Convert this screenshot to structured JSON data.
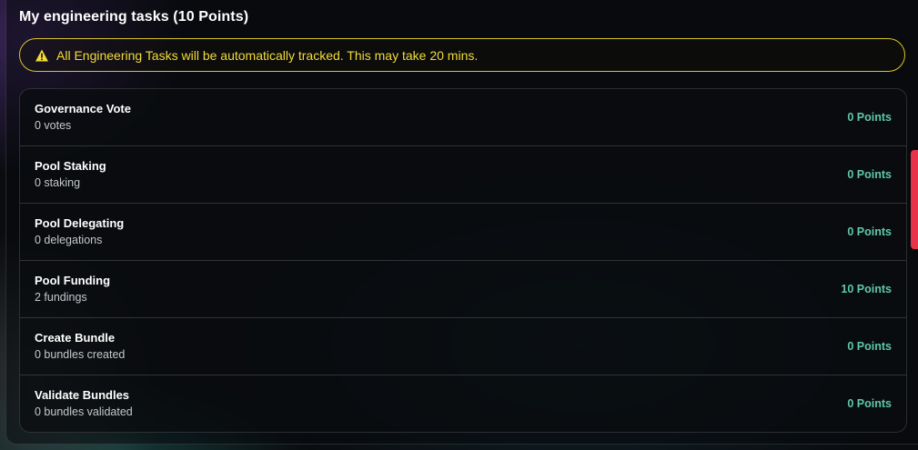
{
  "header": {
    "title": "My engineering tasks (10 Points)"
  },
  "alert": {
    "icon": "warning-icon",
    "text": "All Engineering Tasks will be automatically tracked. This may take 20 mins.",
    "color": "#f3dc38"
  },
  "tasks": [
    {
      "name": "Governance Vote",
      "detail": "0 votes",
      "points": "0 Points"
    },
    {
      "name": "Pool Staking",
      "detail": "0 staking",
      "points": "0 Points"
    },
    {
      "name": "Pool Delegating",
      "detail": "0 delegations",
      "points": "0 Points"
    },
    {
      "name": "Pool Funding",
      "detail": "2 fundings",
      "points": "10 Points"
    },
    {
      "name": "Create Bundle",
      "detail": "0 bundles created",
      "points": "0 Points"
    },
    {
      "name": "Validate Bundles",
      "detail": "0 bundles validated",
      "points": "0 Points"
    }
  ],
  "colors": {
    "accent_points": "#5ec7a8",
    "scrollbar": "#e8334a",
    "alert_border": "#d9c52a"
  }
}
